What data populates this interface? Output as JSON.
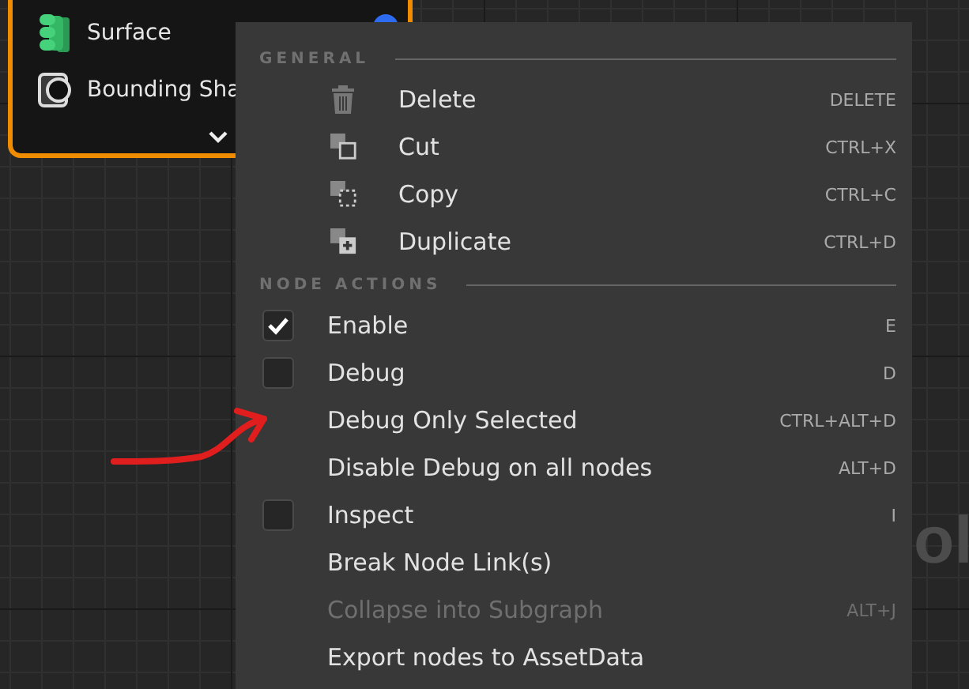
{
  "node": {
    "rows": [
      {
        "label": "Surface"
      },
      {
        "label": "Bounding Sha"
      }
    ]
  },
  "canvas_text": "ol",
  "context_menu": {
    "sections": [
      {
        "title": "GENERAL",
        "items": [
          {
            "kind": "icon",
            "label": "Delete",
            "shortcut": "DELETE",
            "disabled": false
          },
          {
            "kind": "icon",
            "label": "Cut",
            "shortcut": "CTRL+X",
            "disabled": false
          },
          {
            "kind": "icon",
            "label": "Copy",
            "shortcut": "CTRL+C",
            "disabled": false
          },
          {
            "kind": "icon",
            "label": "Duplicate",
            "shortcut": "CTRL+D",
            "disabled": false
          }
        ]
      },
      {
        "title": "NODE ACTIONS",
        "items": [
          {
            "kind": "checkbox",
            "label": "Enable",
            "shortcut": "E",
            "checked": true,
            "disabled": false
          },
          {
            "kind": "checkbox",
            "label": "Debug",
            "shortcut": "D",
            "checked": false,
            "disabled": false
          },
          {
            "kind": "plain",
            "label": "Debug Only Selected",
            "shortcut": "CTRL+ALT+D",
            "disabled": false
          },
          {
            "kind": "plain",
            "label": "Disable Debug on all nodes",
            "shortcut": "ALT+D",
            "disabled": false
          },
          {
            "kind": "checkbox",
            "label": "Inspect",
            "shortcut": "I",
            "checked": false,
            "disabled": false
          },
          {
            "kind": "plain",
            "label": "Break Node Link(s)",
            "disabled": false
          },
          {
            "kind": "plain",
            "label": "Collapse into Subgraph",
            "shortcut": "ALT+J",
            "disabled": true
          },
          {
            "kind": "plain",
            "label": "Export nodes to AssetData",
            "disabled": false
          }
        ]
      }
    ]
  }
}
